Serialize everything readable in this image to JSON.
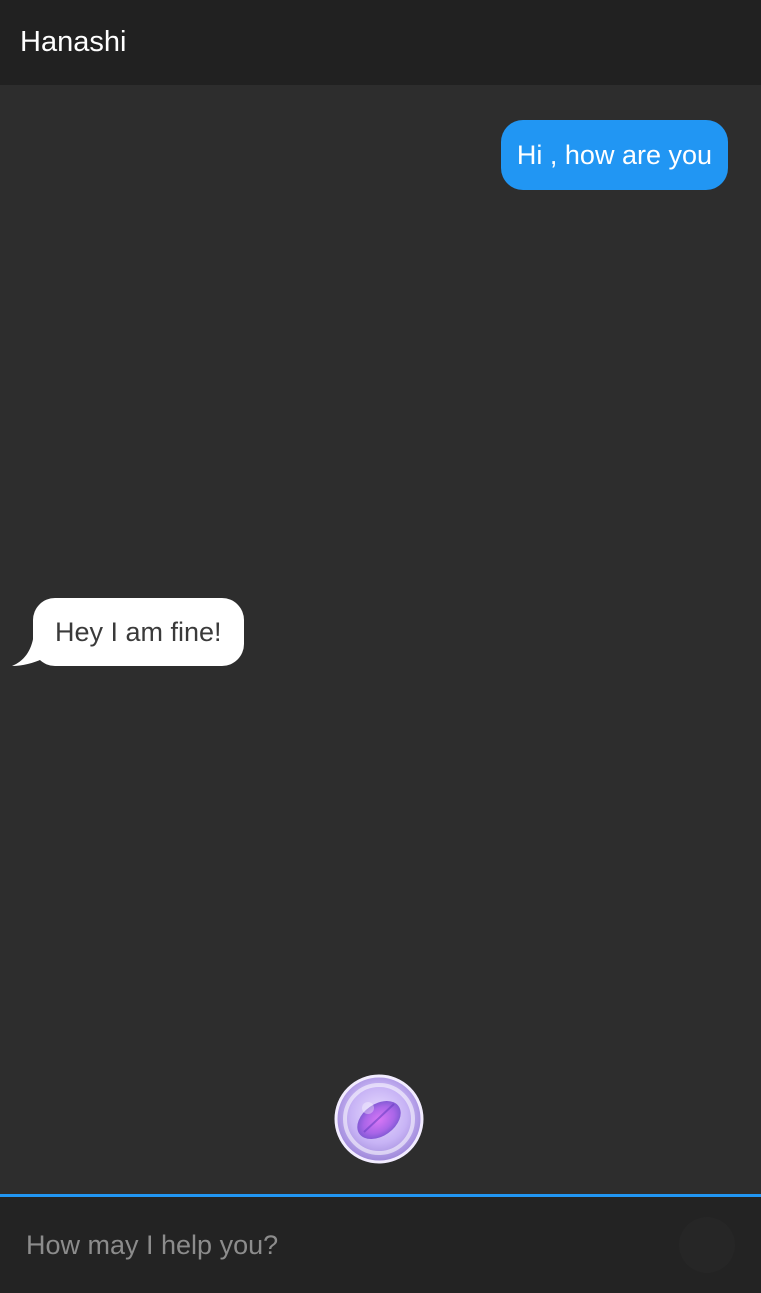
{
  "app": {
    "title": "Hanashi"
  },
  "messages": [
    {
      "sender": "user",
      "text": "Hi , how are you"
    },
    {
      "sender": "bot",
      "text": "Hey I am fine!"
    }
  ],
  "assistant": {
    "icon": "assistant-orb-icon"
  },
  "input": {
    "placeholder": "How may I help you?",
    "value": ""
  },
  "colors": {
    "accent": "#2196f3",
    "background": "#2d2d2d",
    "app_bar": "#212121",
    "user_bubble": "#2196f3",
    "bot_bubble": "#ffffff",
    "orb": "#b38cf5"
  }
}
